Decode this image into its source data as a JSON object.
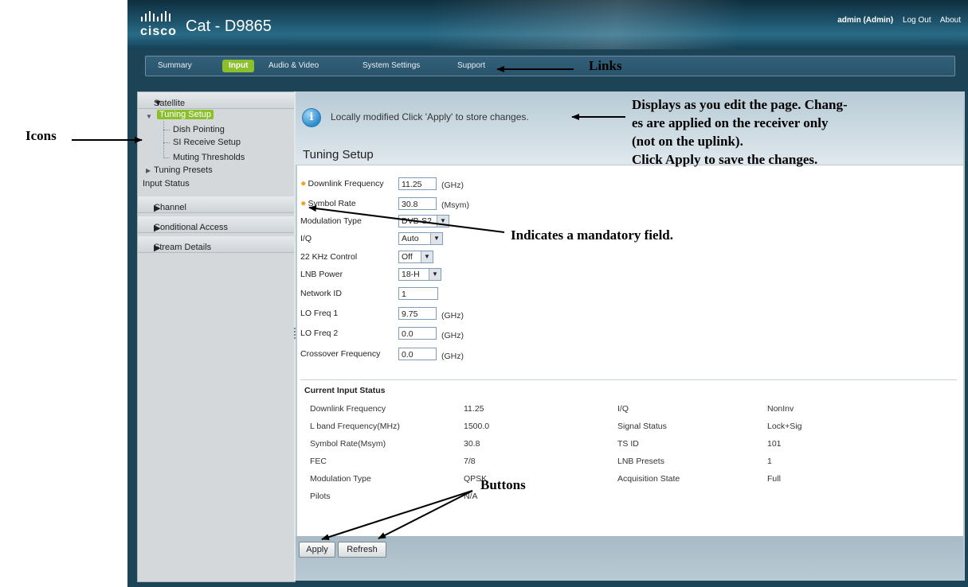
{
  "header": {
    "logo_text": "cisco",
    "product_name": "Cat - D9865",
    "user": "admin (Admin)",
    "logout": "Log Out",
    "about": "About"
  },
  "nav": {
    "tabs": [
      {
        "label": "Summary"
      },
      {
        "label": "Input"
      },
      {
        "label": "Audio & Video"
      },
      {
        "label": "System Settings"
      },
      {
        "label": "Support"
      }
    ]
  },
  "sidebar": {
    "satellite": "Satellite",
    "tuning_setup": "Tuning Setup",
    "dish_pointing": "Dish Pointing",
    "si_receive_setup": "SI Receive Setup",
    "muting_thresholds": "Muting Thresholds",
    "tuning_presets": "Tuning Presets",
    "input_status": "Input Status",
    "channel": "Channel",
    "conditional_access": "Conditional Access",
    "stream_details": "Stream Details"
  },
  "main": {
    "info_message": "Locally modified Click 'Apply' to store changes.",
    "page_title": "Tuning Setup",
    "fields": {
      "downlink_frequency": {
        "label": "Downlink Frequency",
        "value": "11.25",
        "unit": "(GHz)"
      },
      "symbol_rate": {
        "label": "Symbol Rate",
        "value": "30.8",
        "unit": "(Msym)"
      },
      "modulation_type": {
        "label": "Modulation Type",
        "value": "DVB-S2"
      },
      "iq": {
        "label": "I/Q",
        "value": "Auto"
      },
      "khz_control": {
        "label": "22 KHz Control",
        "value": "Off"
      },
      "lnb_power": {
        "label": "LNB Power",
        "value": "18-H"
      },
      "network_id": {
        "label": "Network ID",
        "value": "1"
      },
      "lo_freq_1": {
        "label": "LO Freq 1",
        "value": "9.75",
        "unit": "(GHz)"
      },
      "lo_freq_2": {
        "label": "LO Freq 2",
        "value": "0.0",
        "unit": "(GHz)"
      },
      "crossover_frequency": {
        "label": "Crossover Frequency",
        "value": "0.0",
        "unit": "(GHz)"
      }
    },
    "status": {
      "title": "Current Input Status",
      "left": [
        {
          "label": "Downlink Frequency",
          "value": "11.25"
        },
        {
          "label": "L band Frequency(MHz)",
          "value": "1500.0"
        },
        {
          "label": "Symbol Rate(Msym)",
          "value": "30.8"
        },
        {
          "label": "FEC",
          "value": "7/8"
        },
        {
          "label": "Modulation Type",
          "value": "QPSK"
        },
        {
          "label": "Pilots",
          "value": "N/A"
        }
      ],
      "right": [
        {
          "label": "I/Q",
          "value": "NonInv"
        },
        {
          "label": "Signal Status",
          "value": "Lock+Sig"
        },
        {
          "label": "TS ID",
          "value": "101"
        },
        {
          "label": "LNB Presets",
          "value": "1"
        },
        {
          "label": "Acquisition State",
          "value": "Full"
        }
      ]
    },
    "buttons": {
      "apply": "Apply",
      "refresh": "Refresh"
    }
  },
  "annotations": {
    "links": "Links",
    "icons": "Icons",
    "displays_line1": "Displays as you edit the page. Chang-",
    "displays_line2": "es are applied on the receiver only",
    "displays_line3": "(not on the uplink).",
    "displays_line4": "Click Apply to save the changes.",
    "mandatory": "Indicates a mandatory field.",
    "buttons": "Buttons"
  },
  "colors": {
    "accent_green": "#8bbf2c",
    "header_teal": "#1d5068",
    "required_marker": "#f0a020"
  }
}
